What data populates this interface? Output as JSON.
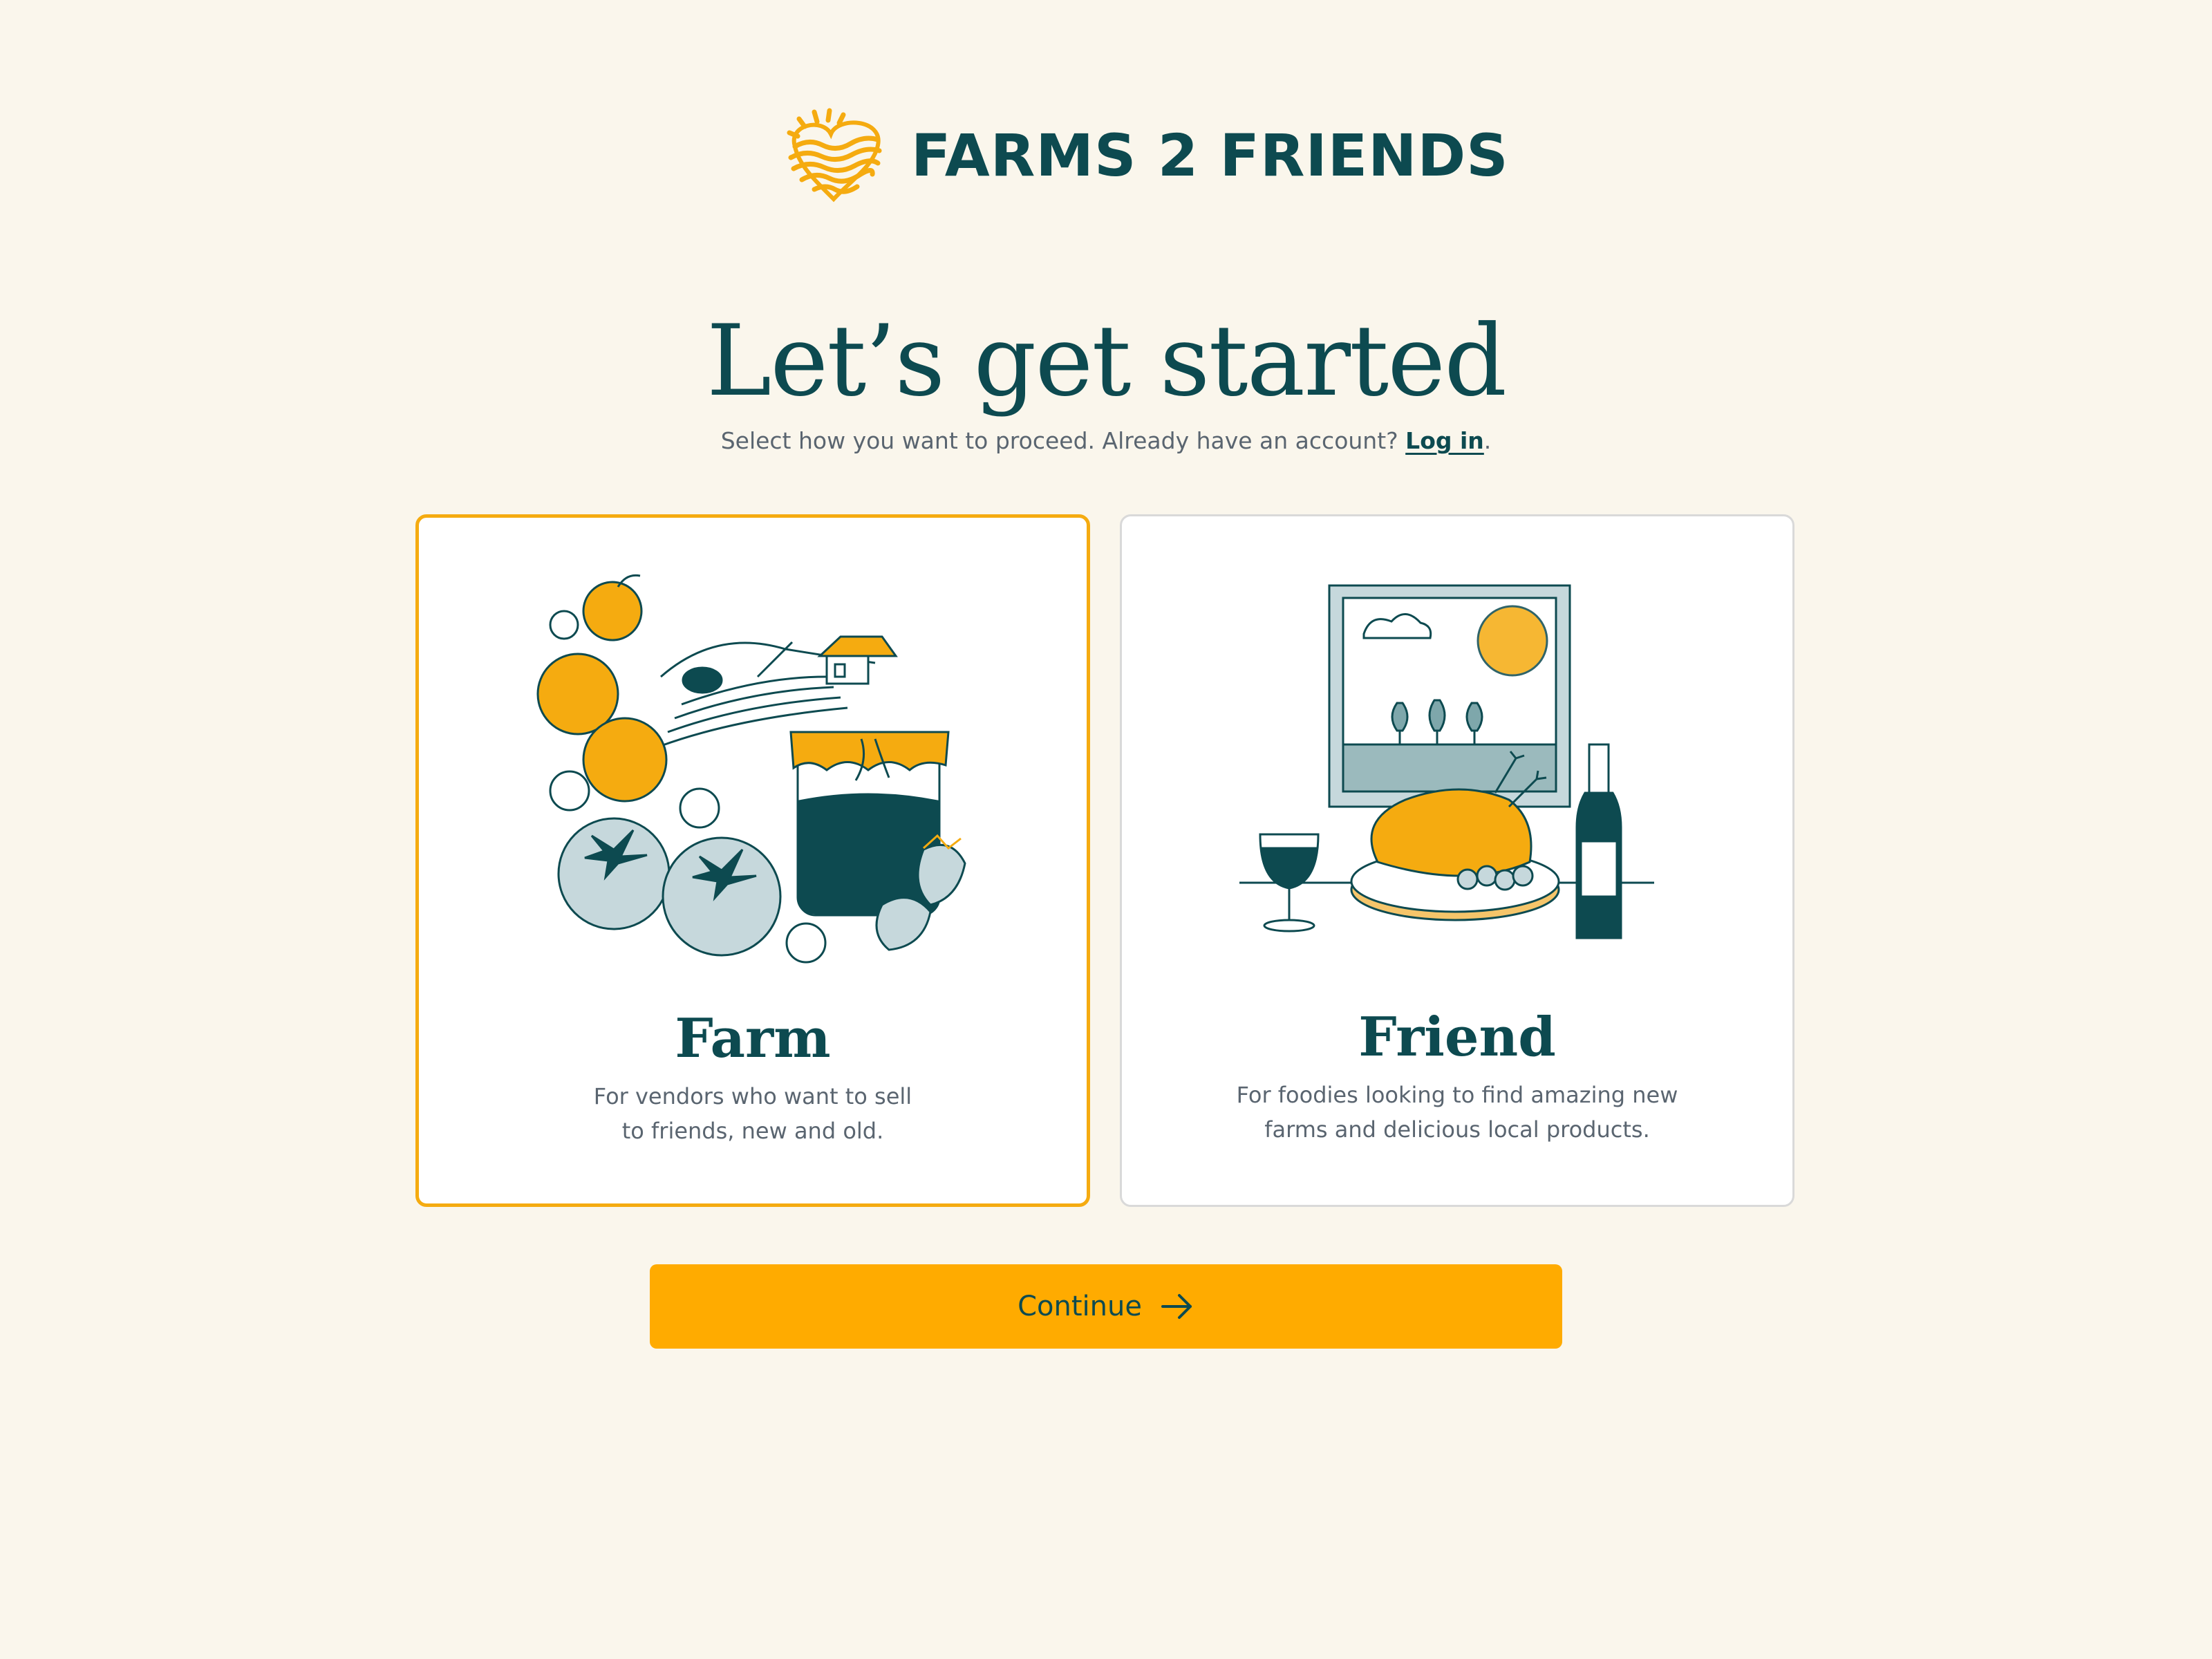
{
  "brand": {
    "name": "FARMS 2 FRIENDS",
    "logo_icon": "sun-heart-icon",
    "colors": {
      "primary": "#0d4a50",
      "accent": "#ffab00",
      "background": "#faf6ec"
    }
  },
  "header": {
    "title": "Let’s get started",
    "subtitle_prefix": "Select how you want to proceed. Already have an account?",
    "login_link": "Log in",
    "subtitle_suffix": "."
  },
  "options": [
    {
      "title": "Farm",
      "desc_line1": "For vendors who want to sell",
      "desc_line2": "to friends, new and old.",
      "illustration": "farm-produce-illustration",
      "selected": true
    },
    {
      "title": "Friend",
      "desc_line1": "For foodies looking to find amazing new",
      "desc_line2": "farms and delicious local products.",
      "illustration": "dinner-table-illustration",
      "selected": false
    }
  ],
  "actions": {
    "continue_label": "Continue",
    "continue_icon": "arrow-right-icon"
  }
}
